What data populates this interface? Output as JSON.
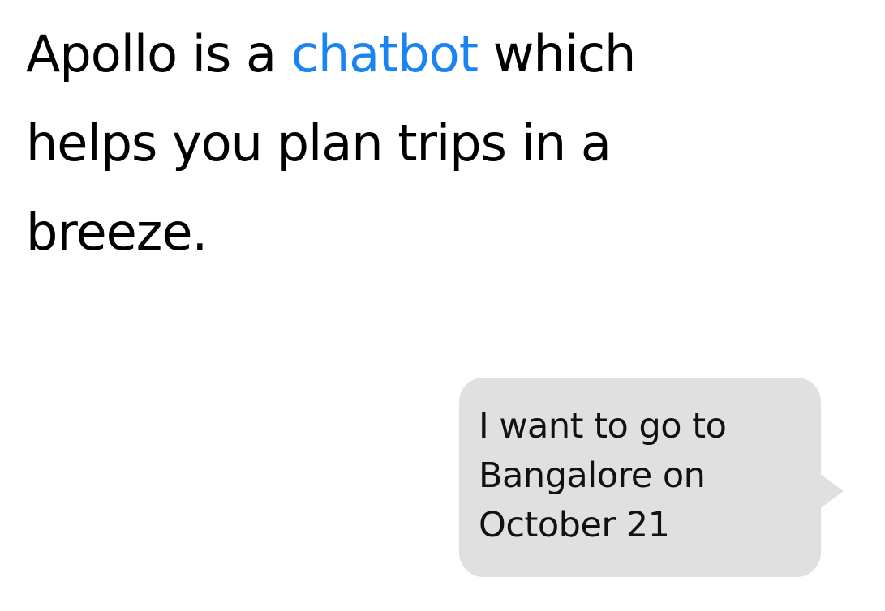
{
  "headline": {
    "line1_before": "Apollo is a ",
    "line1_highlight": "chatbot",
    "line1_after": " which",
    "line2": "helps you plan trips in a",
    "line3": "breeze.",
    "highlight_color": "#1a84f2"
  },
  "chat_message": {
    "lines": [
      "I want to go to",
      "Bangalore on",
      "October 21"
    ],
    "bubble_color": "#e0e0e0"
  }
}
